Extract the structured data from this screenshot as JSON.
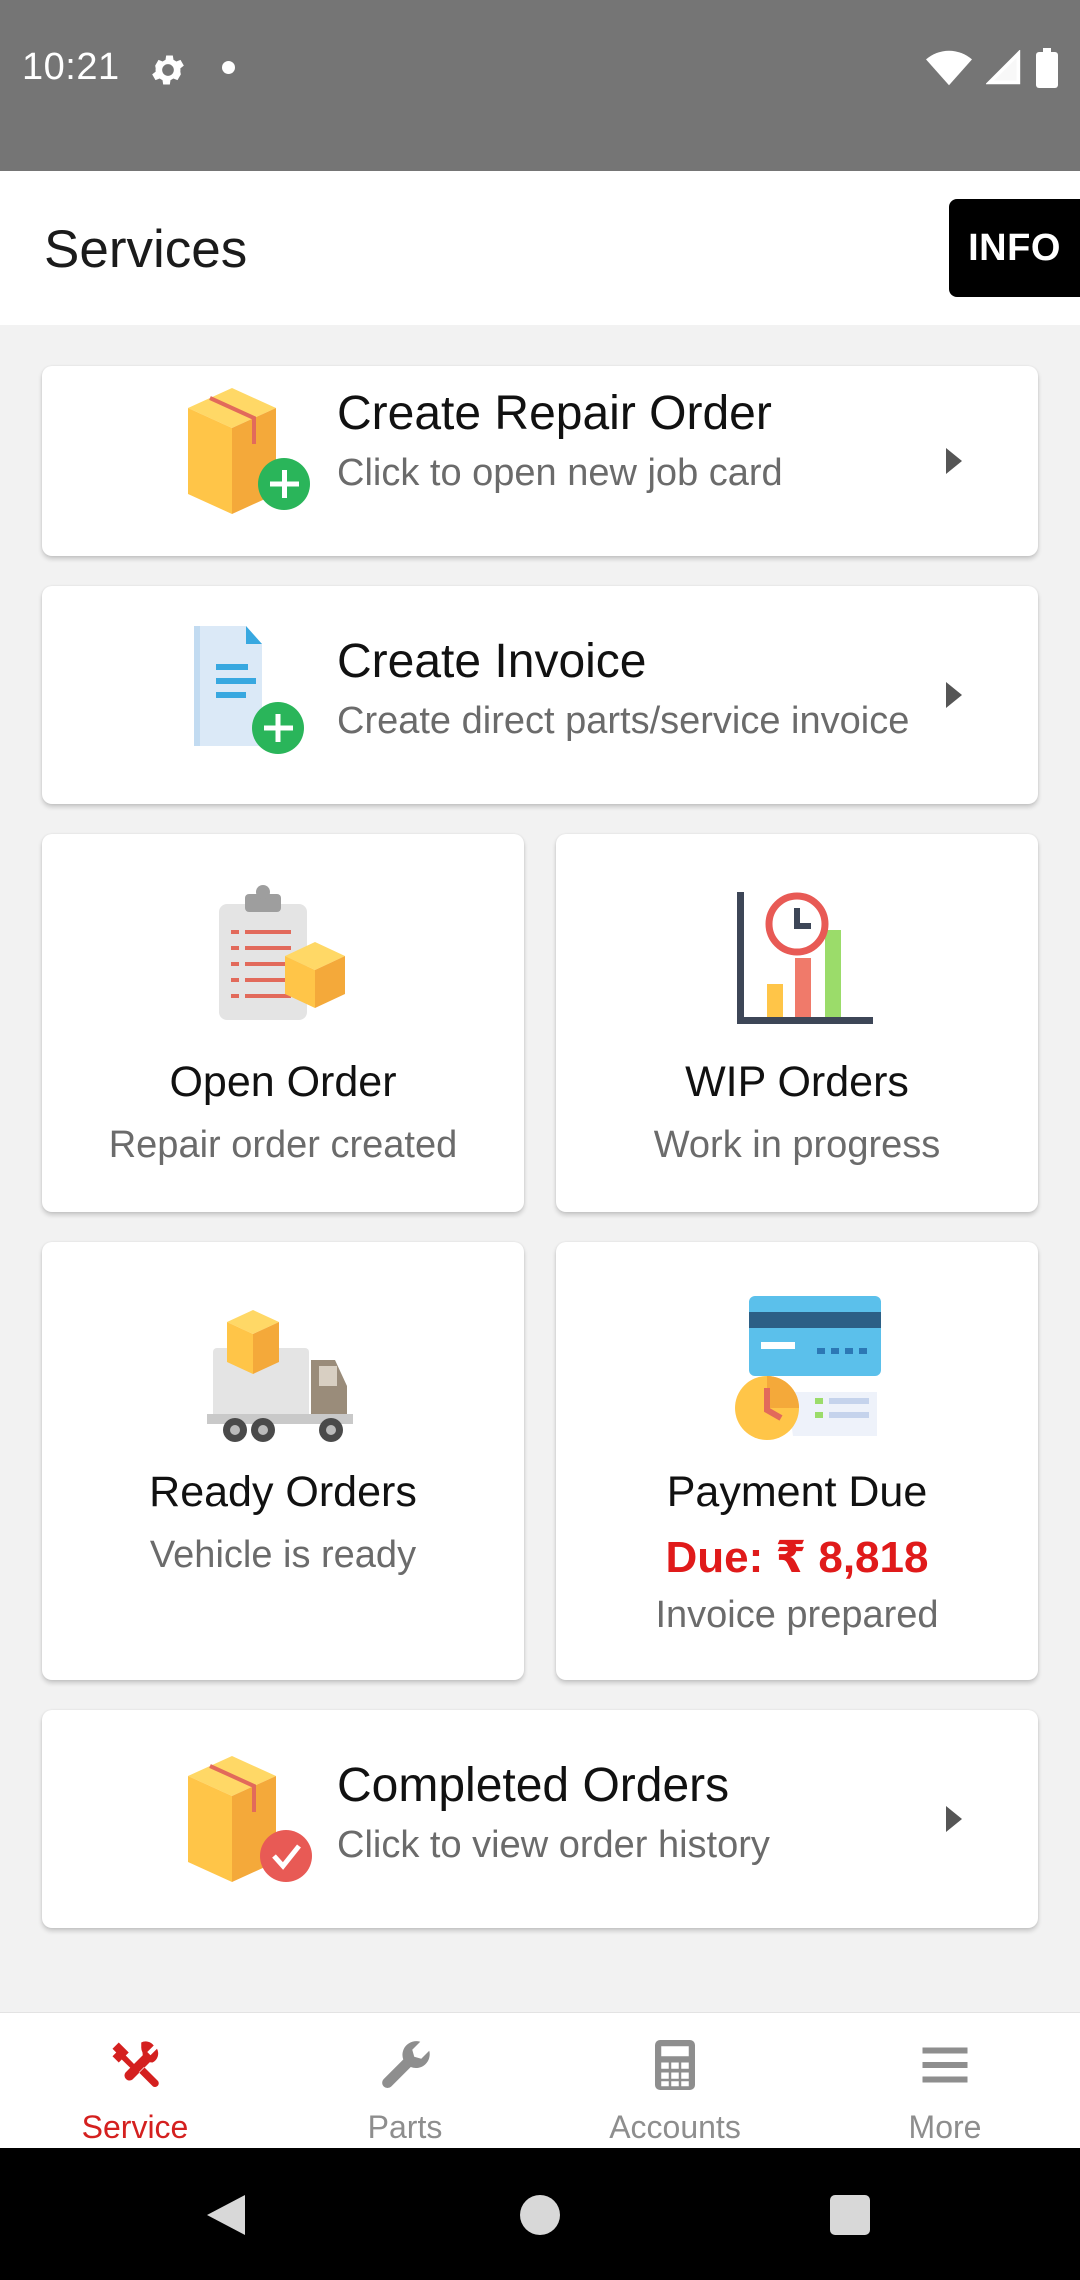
{
  "status_bar": {
    "time": "10:21"
  },
  "app_bar": {
    "title": "Services",
    "info_label": "INFO"
  },
  "create_repair_order": {
    "title": "Create Repair Order",
    "subtitle": "Click to open new job card",
    "icon": "box-add-icon"
  },
  "create_invoice": {
    "title": "Create Invoice",
    "subtitle": "Create direct parts/service invoice",
    "icon": "document-add-icon"
  },
  "open_order": {
    "title": "Open Order",
    "subtitle": "Repair order created",
    "icon": "clipboard-box-icon"
  },
  "wip_orders": {
    "title": "WIP Orders",
    "subtitle": "Work in progress",
    "icon": "chart-clock-icon"
  },
  "ready_orders": {
    "title": "Ready Orders",
    "subtitle": "Vehicle is ready",
    "icon": "delivery-truck-icon"
  },
  "payment_due": {
    "title": "Payment Due",
    "due_text": "Due: ₹ 8,818",
    "subtitle": "Invoice prepared",
    "icon": "credit-card-clock-icon"
  },
  "completed_orders": {
    "title": "Completed Orders",
    "subtitle": "Click to view order history",
    "icon": "box-check-icon"
  },
  "bottom_nav": {
    "items": [
      {
        "label": "Service",
        "icon": "tools-icon",
        "active": true
      },
      {
        "label": "Parts",
        "icon": "wrench-icon",
        "active": false
      },
      {
        "label": "Accounts",
        "icon": "calculator-icon",
        "active": false
      },
      {
        "label": "More",
        "icon": "menu-icon",
        "active": false
      }
    ]
  },
  "colors": {
    "accent": "#d4201f",
    "due_red": "#e01a1a",
    "status_bar": "#757575"
  }
}
